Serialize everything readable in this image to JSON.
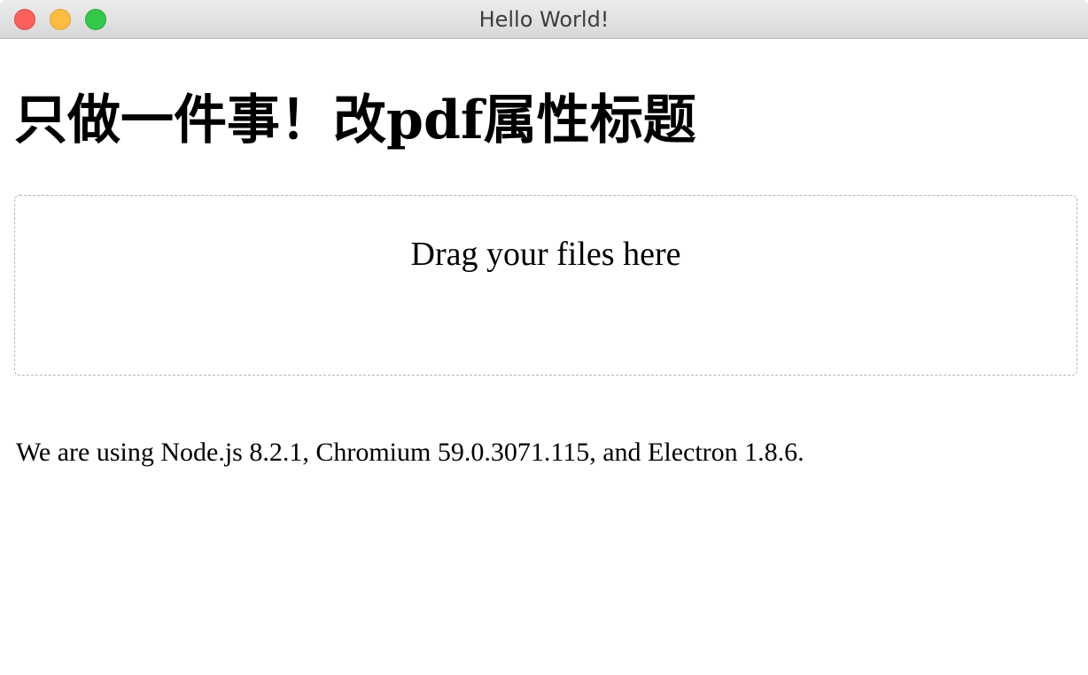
{
  "window": {
    "title": "Hello World!",
    "buttons": [
      "close",
      "minimize",
      "zoom"
    ]
  },
  "main": {
    "heading": "只做一件事！改pdf属性标题",
    "dropzone_text": "Drag your files here",
    "versions_text": "We are using Node.js 8.2.1, Chromium 59.0.3071.115, and Electron 1.8.6."
  }
}
